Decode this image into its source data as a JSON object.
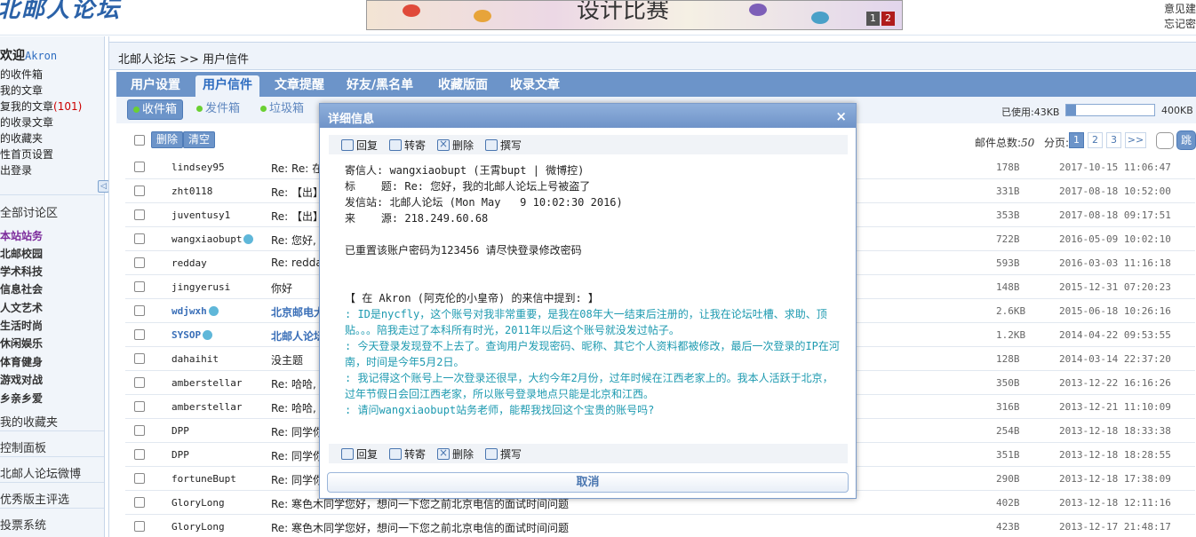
{
  "header": {
    "logo_text": "北邮人论坛",
    "banner_title": "设计比赛",
    "banner_pages": [
      "1",
      "2"
    ],
    "top_links": [
      "意见建",
      "忘记密"
    ]
  },
  "sidebar": {
    "welcome": "欢迎",
    "username": "Akron",
    "links": [
      {
        "label": "的收件箱"
      },
      {
        "label": "我的文章"
      },
      {
        "label": "复我的文章",
        "count": "(101)"
      },
      {
        "label": "的收录文章"
      },
      {
        "label": "的收藏夹"
      },
      {
        "label": "性首页设置"
      },
      {
        "label": "出登录"
      }
    ],
    "collapse_icon": "◁",
    "all_boards": "全部讨论区",
    "boards": [
      "本站站务",
      "北邮校园",
      "学术科技",
      "信息社会",
      "人文艺术",
      "生活时尚",
      "休闲娱乐",
      "体育健身",
      "游戏对战",
      "乡亲乡爱"
    ],
    "favorites": "我的收藏夹",
    "sections": [
      "控制面板",
      "北邮人论坛微博",
      "优秀版主评选",
      "投票系统"
    ]
  },
  "main": {
    "breadcrumb": "北邮人论坛 >> 用户信件",
    "tabs": [
      "用户设置",
      "用户信件",
      "文章提醒",
      "好友/黑名单",
      "收藏版面",
      "收录文章"
    ],
    "active_tab": 1,
    "subtabs": [
      "收件箱",
      "发件箱",
      "垃圾箱"
    ],
    "active_subtab": 0,
    "used_label": "已使用:43KB",
    "used_fraction": 0.1075,
    "quota_label": "400KB",
    "delete_button": "删除",
    "clear_button": "清空",
    "total_label": "邮件总数:",
    "total_value": "50",
    "pages_label": "分页:",
    "pages": [
      "1",
      "2",
      "3",
      ">>"
    ],
    "current_page": "1",
    "jump_button": "跳",
    "messages": [
      {
        "from": "lindsey95",
        "subject": "Re: Re: 在",
        "size": "178B",
        "date": "2017-10-15 11:06:47"
      },
      {
        "from": "zht0118",
        "subject": "Re: 【出】",
        "size": "331B",
        "date": "2017-08-18 10:52:00"
      },
      {
        "from": "juventusy1",
        "subject": "Re: 【出】",
        "size": "353B",
        "date": "2017-08-18 09:17:51"
      },
      {
        "from": "wangxiaobupt",
        "subject": "Re: 您好,",
        "size": "722B",
        "date": "2016-05-09 10:02:10",
        "verified": true
      },
      {
        "from": "redday",
        "subject": "Re: redda",
        "size": "593B",
        "date": "2016-03-03 11:16:18"
      },
      {
        "from": "jingyerusi",
        "subject": "你好",
        "size": "148B",
        "date": "2015-12-31 07:20:23"
      },
      {
        "from": "wdjwxh",
        "subject": "北京邮电大",
        "size": "2.6KB",
        "date": "2015-06-18 10:26:16",
        "verified": true,
        "highlight": true
      },
      {
        "from": "SYSOP",
        "subject": "北邮人论坛",
        "size": "1.2KB",
        "date": "2014-04-22 09:53:55",
        "verified": true,
        "highlight": true
      },
      {
        "from": "dahaihit",
        "subject": "没主题",
        "size": "128B",
        "date": "2014-03-14 22:37:20"
      },
      {
        "from": "amberstellar",
        "subject": "Re: 哈哈,",
        "size": "350B",
        "date": "2013-12-22 16:16:26"
      },
      {
        "from": "amberstellar",
        "subject": "Re: 哈哈,",
        "size": "316B",
        "date": "2013-12-21 11:10:09"
      },
      {
        "from": "DPP",
        "subject": "Re: 同学你",
        "size": "254B",
        "date": "2013-12-18 18:33:38"
      },
      {
        "from": "DPP",
        "subject": "Re: 同学你",
        "size": "351B",
        "date": "2013-12-18 18:28:55"
      },
      {
        "from": "fortuneBupt",
        "subject": "Re: 同学你",
        "size": "290B",
        "date": "2013-12-18 17:38:09"
      },
      {
        "from": "GloryLong",
        "subject": "Re: 寒色木同学您好，想问一下您之前北京电信的面试时间问题",
        "size": "402B",
        "date": "2013-12-18 12:11:16"
      },
      {
        "from": "GloryLong",
        "subject": "Re: 寒色木同学您好，想问一下您之前北京电信的面试时间问题",
        "size": "423B",
        "date": "2013-12-17 21:48:17"
      }
    ]
  },
  "dialog": {
    "title": "详细信息",
    "close_icon": "×",
    "tools": [
      "回复",
      "转寄",
      "删除",
      "撰写"
    ],
    "header_lines": [
      "寄信人: wangxiaobupt (王霄bupt | 微博控)",
      "标    题: Re: 您好，我的北邮人论坛上号被盗了",
      "发信站: 北邮人论坛 (Mon May   9 10:02:30 2016)",
      "来    源: 218.249.60.68"
    ],
    "body_line": "已重置该账户密码为123456 请尽快登录修改密码",
    "quote_intro": "【 在 Akron (阿克伦的小皇帝) 的来信中提到: 】",
    "quote_lines": [
      ": ID是nycfly，这个账号对我非常重要，是我在08年大一结束后注册的，让我在论坛吐槽、求助、顶贴。。。陪我走过了本科所有时光，2011年以后这个账号就没发过帖子。",
      ": 今天登录发现登不上去了。查询用户发现密码、昵称、其它个人资料都被修改，最后一次登录的IP在河南，时间是今年5月2日。",
      ": 我记得这个账号上一次登录还很早，大约今年2月份，过年时候在江西老家上的。我本人活跃于北京，过年节假日会回江西老家，所以账号登录地点只能是北京和江西。",
      ": 请问wangxiaobupt站务老师，能帮我找回这个宝贵的账号吗?"
    ],
    "cancel_button": "取消"
  },
  "colors": {
    "nav_blue": "#6c94c9",
    "link_blue": "#3a6fb8",
    "quote_teal": "#1d9ab0",
    "count_red": "#cc0000"
  }
}
